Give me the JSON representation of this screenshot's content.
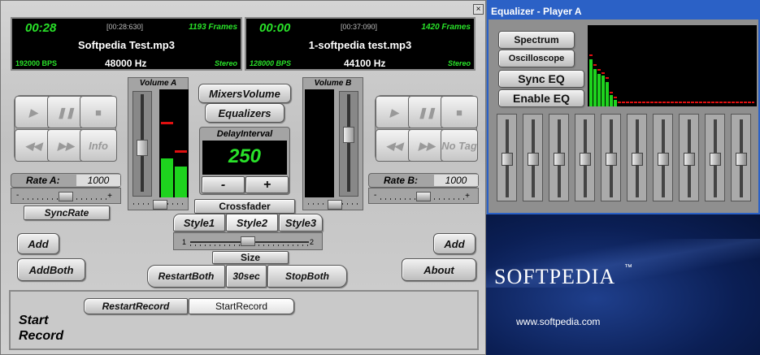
{
  "player_a": {
    "time": "00:28",
    "timecode": "[00:28:630]",
    "frames": "1193 Frames",
    "file": "Softpedia Test.mp3",
    "bps": "192000 BPS",
    "hz": "48000 Hz",
    "mode": "Stereo"
  },
  "player_b": {
    "time": "00:00",
    "timecode": "[00:37:090]",
    "frames": "1420 Frames",
    "file": "1-softpedia test.mp3",
    "bps": "128000 BPS",
    "hz": "44100 Hz",
    "mode": "Stereo"
  },
  "volume_a_label": "Volume A",
  "volume_b_label": "Volume B",
  "mixers_volume": "MixersVolume",
  "equalizers": "Equalizers",
  "delay_label": "DelayInterval",
  "delay_value": "250",
  "minus": "-",
  "plus": "+",
  "info": "Info",
  "no_tag": "No Tag",
  "rate_a_label": "Rate A:",
  "rate_a_value": "1000",
  "rate_b_label": "Rate B:",
  "rate_b_value": "1000",
  "sync_rate": "SyncRate",
  "crossfader": "Crossfader",
  "styles": [
    "Style1",
    "Style2",
    "Style3"
  ],
  "cross_min": "1",
  "cross_max": "2",
  "size": "Size",
  "add_left": "Add",
  "add_both": "AddBoth",
  "add_right": "Add",
  "about": "About",
  "restart_both": "RestartBoth",
  "sec30": "30sec",
  "stop_both": "StopBoth",
  "restart_record": "RestartRecord",
  "start_record_btn": "StartRecord",
  "start_record_label": "Start Record",
  "slider_min": "-",
  "slider_max": "+",
  "eq_title": "Equalizer - Player A",
  "spectrum": "Spectrum",
  "oscilloscope": "Oscilloscope",
  "sync_eq": "Sync EQ",
  "enable_eq": "Enable EQ",
  "brand": "SOFTPEDIA",
  "brand_tm": "™",
  "brand_url": "www.softpedia.com",
  "colors": {
    "lcd_green": "#29e229",
    "eq_title_bar": "#2b61c6",
    "meter_red": "#e01010"
  }
}
